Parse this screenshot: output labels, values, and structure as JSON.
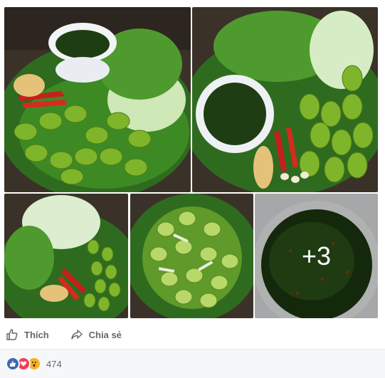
{
  "post": {
    "more_photos_label": "+3",
    "photos": [
      {
        "name": "photo-1",
        "alt_icon": "photo"
      },
      {
        "name": "photo-2",
        "alt_icon": "photo"
      },
      {
        "name": "photo-3",
        "alt_icon": "photo"
      },
      {
        "name": "photo-4",
        "alt_icon": "photo"
      },
      {
        "name": "photo-5",
        "alt_icon": "photo"
      }
    ]
  },
  "actions": {
    "like_label": "Thích",
    "share_label": "Chia sẻ"
  },
  "reactions": {
    "count": "474",
    "types": [
      "like",
      "love",
      "wow"
    ],
    "colors": {
      "like": "#4267b2",
      "love": "#f33e58",
      "wow": "#f7b125"
    }
  },
  "colors": {
    "text_muted": "#616770",
    "bar_bg": "#f6f7f9"
  }
}
